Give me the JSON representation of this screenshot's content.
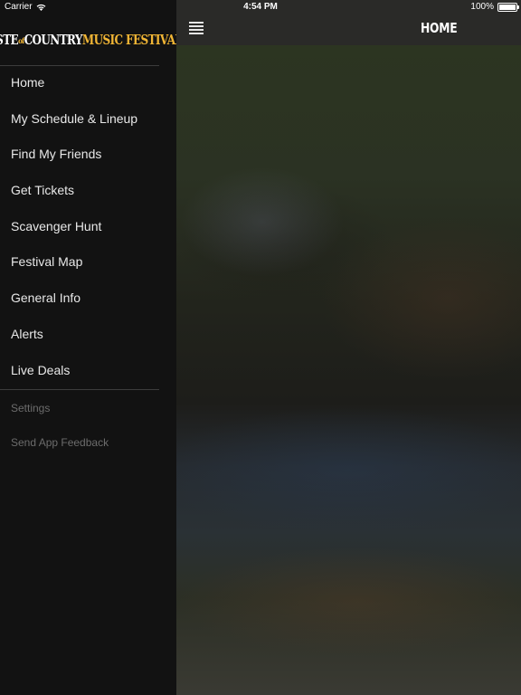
{
  "status_bar": {
    "carrier": "Carrier",
    "time": "4:54 PM",
    "battery": "100%",
    "battery_level": 1.0
  },
  "sidebar": {
    "logo": {
      "part1": "TASTE",
      "part2": "of",
      "part3": "COUNTRY",
      "part4": "MUSIC FESTIVAL"
    },
    "items": [
      {
        "label": "Home"
      },
      {
        "label": "My Schedule & Lineup"
      },
      {
        "label": "Find My Friends"
      },
      {
        "label": "Get Tickets"
      },
      {
        "label": "Scavenger Hunt"
      },
      {
        "label": "Festival Map"
      },
      {
        "label": "General Info"
      },
      {
        "label": "Alerts"
      },
      {
        "label": "Live Deals"
      }
    ],
    "secondary_items": [
      {
        "label": "Settings"
      },
      {
        "label": "Send App Feedback"
      }
    ]
  },
  "header": {
    "title": "HOME",
    "menu_icon": "hamburger-icon"
  },
  "colors": {
    "sidebar_bg": "#121212",
    "navbar_bg": "#2a2a28",
    "logo_accent": "#f2b635"
  }
}
